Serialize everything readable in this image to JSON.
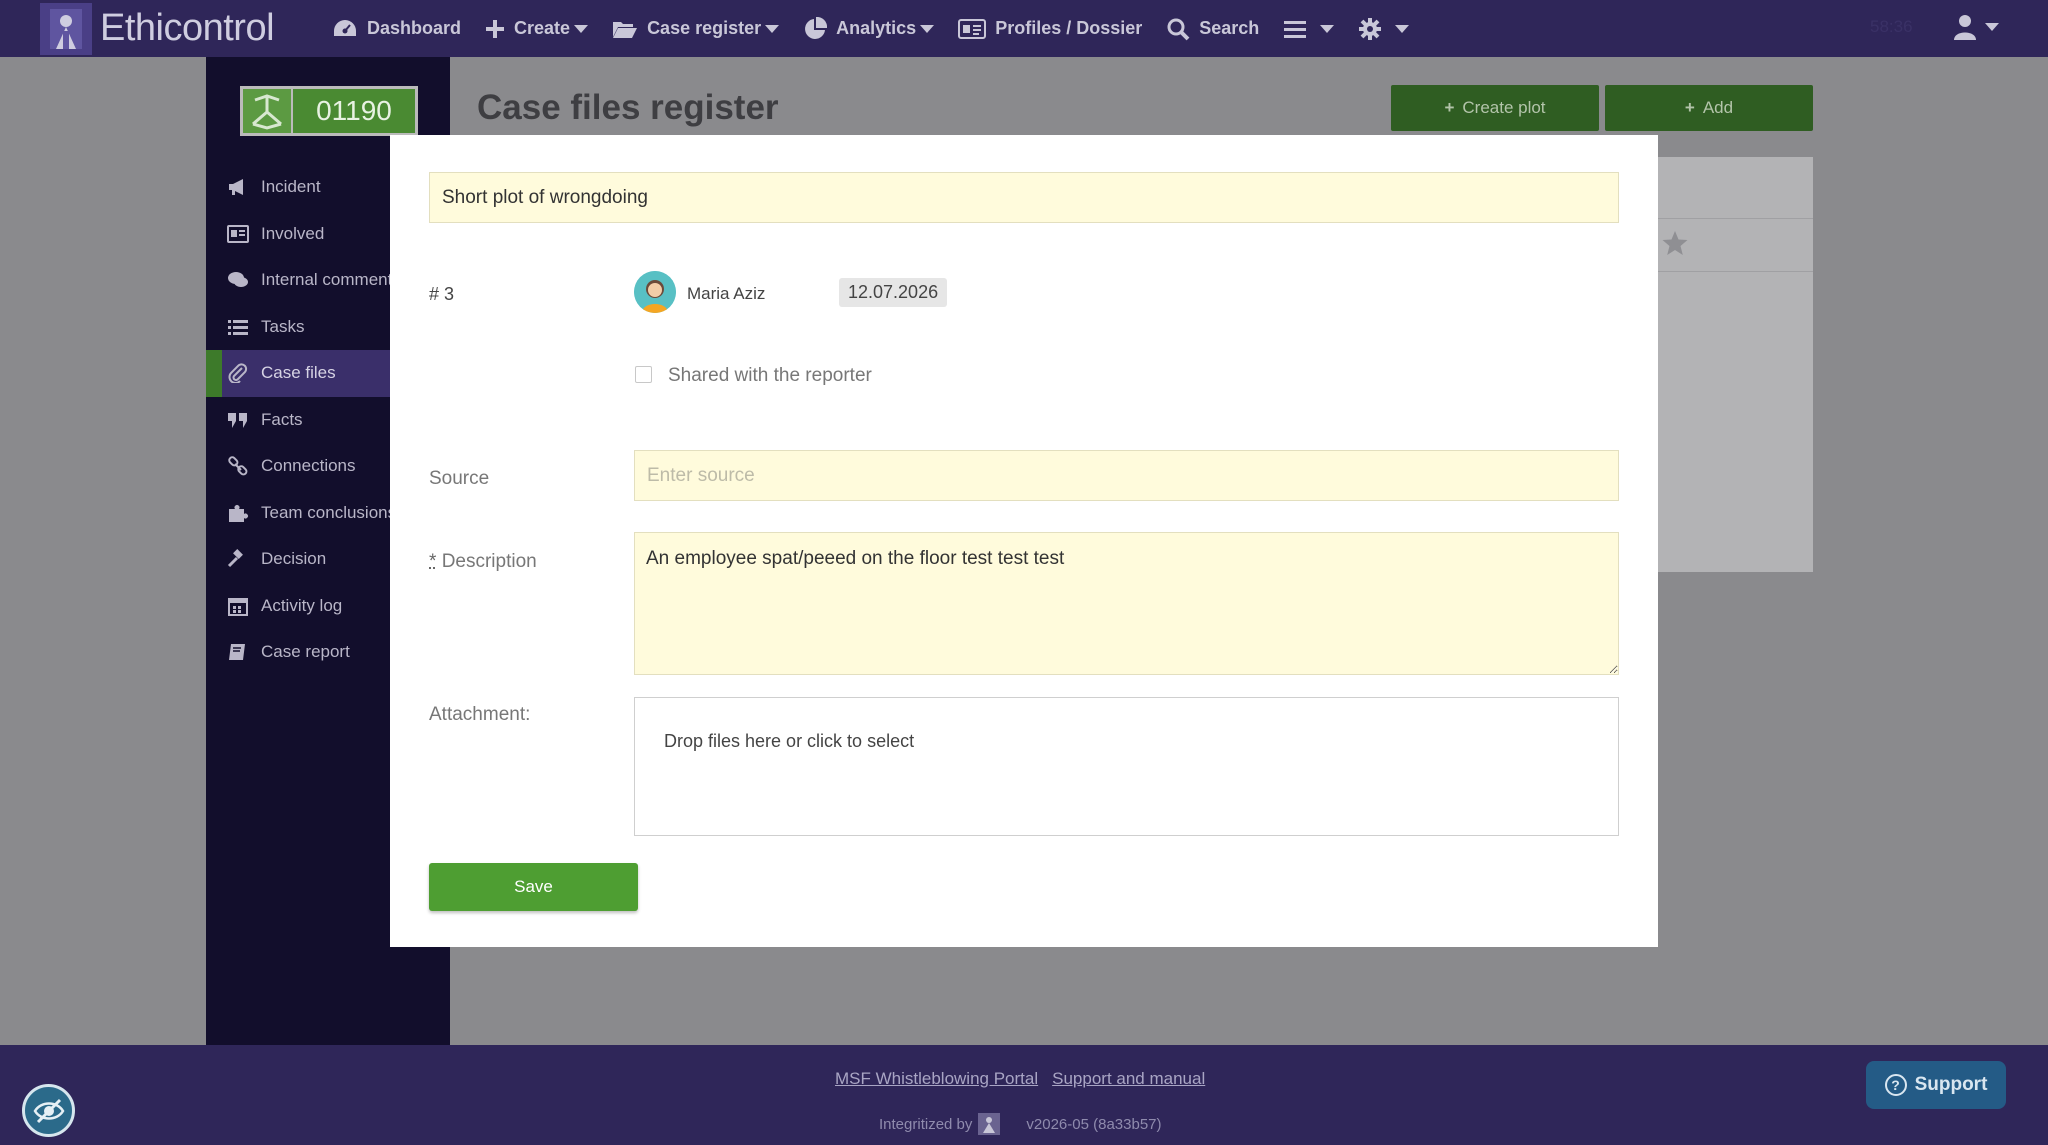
{
  "brand": {
    "name": "Ethicontrol"
  },
  "nav": {
    "dashboard": "Dashboard",
    "create": "Create",
    "case_register": "Case register",
    "analytics": "Analytics",
    "profiles": "Profiles / Dossier",
    "search": "Search",
    "clock": "58:36"
  },
  "sidebar": {
    "case_number": "01190",
    "items": [
      {
        "label": "Incident",
        "icon": "megaphone-icon"
      },
      {
        "label": "Involved",
        "icon": "id-card-icon"
      },
      {
        "label": "Internal comments",
        "icon": "comments-icon"
      },
      {
        "label": "Tasks",
        "icon": "list-icon"
      },
      {
        "label": "Case files",
        "icon": "paperclip-icon"
      },
      {
        "label": "Facts",
        "icon": "quote-icon"
      },
      {
        "label": "Connections",
        "icon": "link-icon"
      },
      {
        "label": "Team conclusions",
        "icon": "puzzle-icon"
      },
      {
        "label": "Decision",
        "icon": "gavel-icon"
      },
      {
        "label": "Activity log",
        "icon": "calendar-icon"
      },
      {
        "label": "Case report",
        "icon": "book-icon"
      }
    ],
    "active_index": 4
  },
  "main": {
    "title": "Case files register",
    "create_plot_label": "Create plot",
    "add_label": "Add"
  },
  "modal": {
    "plot_value": "Short plot of wrongdoing",
    "number": "# 3",
    "author": "Maria Aziz",
    "date": "12.07.2026",
    "shared_label": "Shared with the reporter",
    "shared_checked": false,
    "source_label": "Source",
    "source_placeholder": "Enter source",
    "source_value": "",
    "description_required_mark": "*",
    "description_label": "Description",
    "description_value": "An employee spat/peeed on the floor test test test",
    "attachment_label": "Attachment:",
    "dropzone_text": "Drop files here or click to select",
    "save_label": "Save"
  },
  "footer": {
    "portal_link": "MSF Whistleblowing Portal",
    "support_link": "Support and manual",
    "integritized": "Integritized by",
    "version": "v2026-05 (8a33b57)",
    "support_button": "Support"
  },
  "colors": {
    "topbar": "#2f2659",
    "sidebar": "#120e2c",
    "accent_green": "#4e9e32",
    "input_bg": "#fffbdc"
  }
}
